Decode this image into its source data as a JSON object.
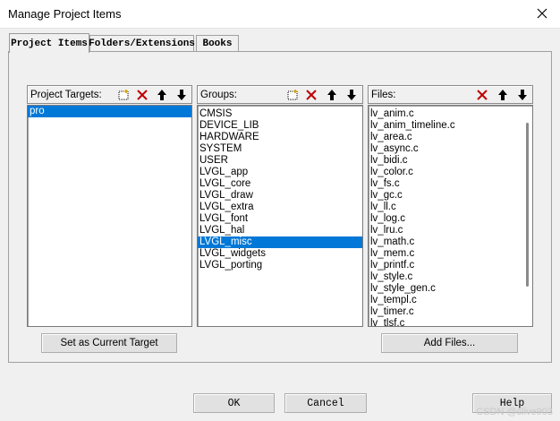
{
  "window": {
    "title": "Manage Project Items"
  },
  "tabs": [
    {
      "label": "Project Items"
    },
    {
      "label": "Folders/Extensions"
    },
    {
      "label": "Books"
    }
  ],
  "targets": {
    "label": "Project Targets:",
    "items": [
      "pro"
    ],
    "selected_index": 0,
    "set_current_label": "Set as Current Target"
  },
  "groups": {
    "label": "Groups:",
    "items": [
      "CMSIS",
      "DEVICE_LIB",
      "HARDWARE",
      "SYSTEM",
      "USER",
      "LVGL_app",
      "LVGL_core",
      "LVGL_draw",
      "LVGL_extra",
      "LVGL_font",
      "LVGL_hal",
      "LVGL_misc",
      "LVGL_widgets",
      "LVGL_porting"
    ],
    "selected_index": 11
  },
  "files": {
    "label": "Files:",
    "items": [
      "lv_anim.c",
      "lv_anim_timeline.c",
      "lv_area.c",
      "lv_async.c",
      "lv_bidi.c",
      "lv_color.c",
      "lv_fs.c",
      "lv_gc.c",
      "lv_ll.c",
      "lv_log.c",
      "lv_lru.c",
      "lv_math.c",
      "lv_mem.c",
      "lv_printf.c",
      "lv_style.c",
      "lv_style_gen.c",
      "lv_templ.c",
      "lv_timer.c",
      "lv_tlsf.c"
    ],
    "add_files_label": "Add Files..."
  },
  "footer": {
    "ok_label": "OK",
    "cancel_label": "Cancel",
    "help_label": "Help"
  },
  "watermark": "CSDN @clive903",
  "colors": {
    "selection": "#0078d7",
    "delete_icon": "#c00000"
  }
}
